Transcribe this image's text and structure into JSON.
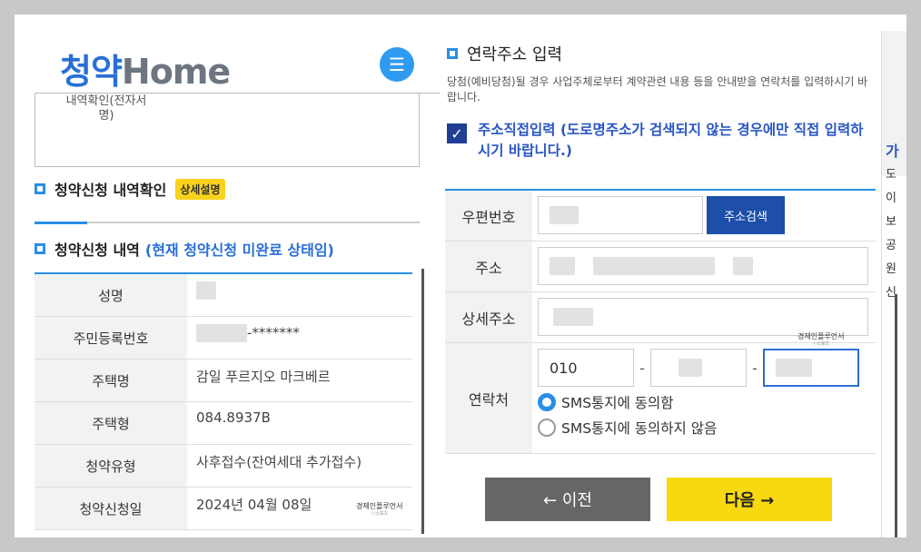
{
  "left": {
    "logo_ko": "청약",
    "logo_en": "Home",
    "menu_icon": "hamburger-icon",
    "sign_label": "내역확인(전자서명)",
    "section1_title": "청약신청 내역확인",
    "section1_badge": "상세설명",
    "section2_title": "청약신청 내역",
    "section2_status": "(현재 청약신청 미완료 상태임)",
    "rows": [
      {
        "label": "성명",
        "value": ""
      },
      {
        "label": "주민등록번호",
        "value": "-*******"
      },
      {
        "label": "주택명",
        "value": "감일 푸르지오 마크베르"
      },
      {
        "label": "주택형",
        "value": "084.8937B"
      },
      {
        "label": "청약유형",
        "value": "사후접수(잔여세대 추가접수)"
      },
      {
        "label": "청약신청일",
        "value": "2024년 04월 08일"
      }
    ],
    "stamp_text": "경제인플루언서",
    "stamp_sub": "ⓒ스포츠"
  },
  "right": {
    "title": "연락주소 입력",
    "description": "당첨(예비당첨)될 경우 사업주체로부터 계약관련 내용 등을 안내받을 연락처를 입력하시기 바랍니다.",
    "checkbox_label": "주소직접입력 (도로명주소가 검색되지 않는 경우에만 직접 입력하시기 바랍니다.)",
    "postal_label": "우편번호",
    "search_button": "주소검색",
    "address_label": "주소",
    "detail_label": "상세주소",
    "contact_label": "연락처",
    "phone1": "010",
    "dash": "-",
    "sms_agree": "SMS통지에 동의함",
    "sms_disagree": "SMS통지에 동의하지 않음",
    "prev_button": "← 이전",
    "next_button": "다음 →",
    "stamp_text": "경제인플루언서",
    "stamp_sub": "ⓒ스포츠"
  },
  "far": {
    "letters": [
      "가",
      "도",
      "이",
      "보",
      "공",
      "원",
      "신"
    ]
  }
}
